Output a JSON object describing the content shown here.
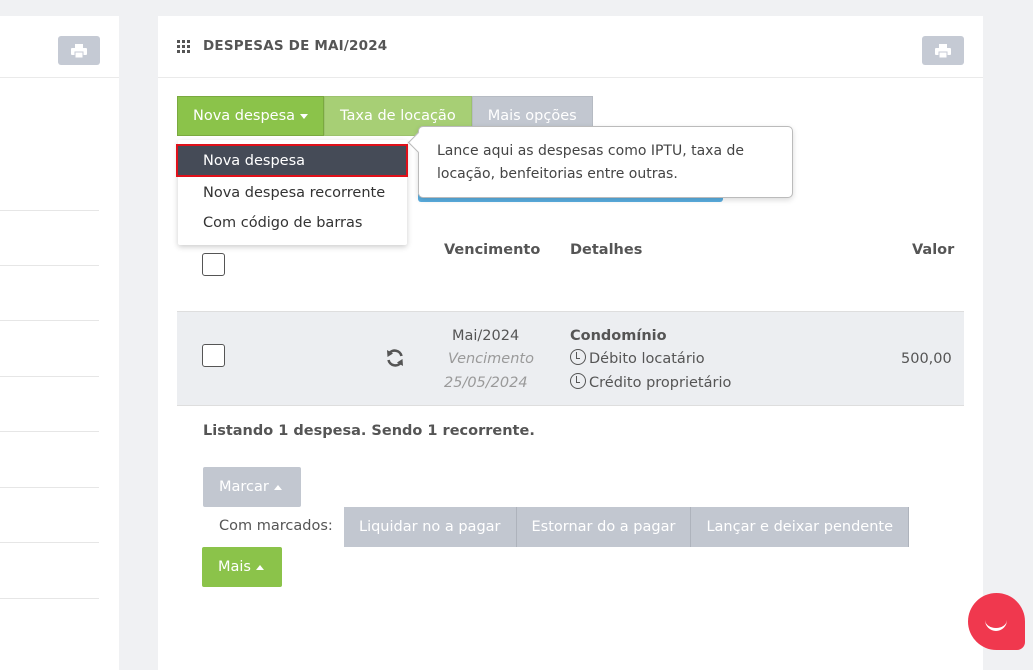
{
  "card": {
    "title": "DESPESAS DE MAI/2024"
  },
  "toolbar": {
    "nova_despesa": "Nova despesa",
    "taxa_locacao": "Taxa de locação",
    "mais_opcoes": "Mais opções"
  },
  "dropdown": {
    "items": [
      {
        "label": "Nova despesa"
      },
      {
        "label": "Nova despesa recorrente"
      },
      {
        "label": "Com código de barras"
      }
    ]
  },
  "tooltip": {
    "text": "Lance aqui as despesas como IPTU, taxa de locação, benfeitorias entre outras."
  },
  "table": {
    "headers": {
      "vencimento": "Vencimento",
      "detalhes": "Detalhes",
      "valor": "Valor"
    },
    "rows": [
      {
        "month": "Mai/2024",
        "due_label": "Vencimento",
        "due_date": "25/05/2024",
        "title": "Condomínio",
        "debit": "Débito locatário",
        "credit": "Crédito proprietário",
        "value": "500,00"
      }
    ]
  },
  "summary": "Listando 1 despesa. Sendo 1 recorrente.",
  "actions": {
    "marcar": "Marcar",
    "with_marked": "Com marcados:",
    "liquidar": "Liquidar no a pagar",
    "estornar": "Estornar do a pagar",
    "lancar": "Lançar e deixar pendente",
    "mais": "Mais"
  },
  "colors": {
    "green": "#8bc34a",
    "gray_button": "#c2c7d0",
    "dark_active": "#454b57",
    "highlight_red": "#e0101a",
    "chat": "#f0384e"
  },
  "icons": [
    "print-icon",
    "grid-icon",
    "refresh-icon",
    "clock-icon",
    "chat-icon"
  ]
}
